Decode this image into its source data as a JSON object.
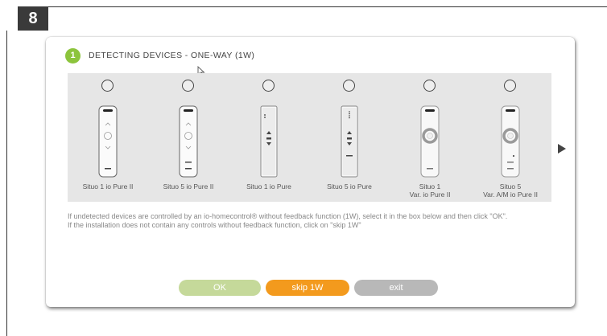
{
  "step_number": "8",
  "dialog": {
    "step_index": "1",
    "title": "DETECTING DEVICES - ONE-WAY (1W)"
  },
  "devices": [
    {
      "label": "Situo 1 io Pure II",
      "style": "white-buttons"
    },
    {
      "label": "Situo 5 io Pure II",
      "style": "white-buttons"
    },
    {
      "label": "Situo 1 io Pure",
      "style": "white-arrows"
    },
    {
      "label": "Situo 5 io Pure",
      "style": "white-arrows"
    },
    {
      "label": "Situo 1\nVar. io Pure II",
      "style": "variation"
    },
    {
      "label": "Situo 5\nVar. A/M io Pure II",
      "style": "variation"
    }
  ],
  "instructions": {
    "line1": "If undetected devices are controlled by an io-homecontrol® without feedback function (1W), select it in the box below and then click \"OK\".",
    "line2": "If the installation does not contain any controls without feedback function, click on \"skip 1W\""
  },
  "buttons": {
    "ok": "OK",
    "skip": "skip 1W",
    "exit": "exit"
  },
  "colors": {
    "accent_green": "#8cc43c",
    "ok_button": "#c5d99a",
    "skip_button": "#f39a1d",
    "exit_button": "#b8b8b8"
  }
}
